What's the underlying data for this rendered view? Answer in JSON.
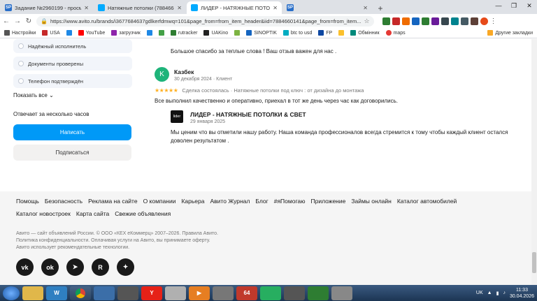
{
  "browser": {
    "tabs": [
      {
        "label": "Задание №2960199 - просмотр з",
        "favicon": "SP",
        "color": "#2a6fc9"
      },
      {
        "label": "Натяжные потолки (7884660141)",
        "favicon": "",
        "color": "#00aaff"
      },
      {
        "label": "ЛИДЕР - НАТЯЖНЫЕ ПОТОЛКИ & С",
        "favicon": "",
        "color": "#00aaff"
      },
      {
        "label": "",
        "favicon": "SP",
        "color": "#2a6fc9"
      }
    ],
    "url": "https://www.avito.ru/brands/i3677684637gdlkerfdmwq=101&page_from=from_item_header&iid=7884660141&page_from=from_item...",
    "bookmarks": [
      "Настройки",
      "USA",
      "",
      "YouTube",
      "загрузчик",
      "",
      "",
      "rutracker",
      "UAKino",
      "",
      "SINOPTIK",
      "btc to usd",
      "FP",
      "",
      "Обмінник",
      "maps"
    ],
    "bookmarks_right": "Другие закладки"
  },
  "sidebar": {
    "features": [
      "Надёжный исполнитель",
      "Документы проверены",
      "Телефон подтверждён"
    ],
    "show_all": "Показать все",
    "replies_note": "Отвечает за несколько часов",
    "write_button": "Написать",
    "subscribe_button": "Подписаться"
  },
  "reviews": {
    "previous_answer": "Большое спасибо за теплые слова ! Ваш отзыв важен для нас .",
    "review": {
      "avatar_letter": "K",
      "name": "Казбек",
      "meta": "30 декабря 2024 · Клиент",
      "stars": "★★★★★",
      "deal": "Сделка состоялась · Натяжные потолки под ключ : от дизайна до монтажа",
      "text": "Все выполнил качественно и оперативно, приехал в тот же день через час как договорились."
    },
    "reply": {
      "logo": "lider",
      "name": "ЛИДЕР - НАТЯЖНЫЕ ПОТОЛКИ & СВЕТ",
      "date": "29 января 2025",
      "text": "Мы ценим что вы отметили нашу работу. Наша команда профессионалов всегда стремится к тому чтобы каждый клиент остался доволен результатом ."
    }
  },
  "footer": {
    "links_row1": [
      "Помощь",
      "Безопасность",
      "Реклама на сайте",
      "О компании",
      "Карьера",
      "Авито Журнал",
      "Блог",
      "#яПомогаю",
      "Приложение",
      "Займы онлайн",
      "Каталог автомобилей"
    ],
    "links_row2": [
      "Каталог новостроек",
      "Карта сайта",
      "Свежие объявления"
    ],
    "legal_line1": "Авито — сайт объявлений России. © ООО «КЕХ еКоммерц» 2007–2026. Правила Авито.",
    "legal_line2": "Политика конфиденциальности. Оплачивая услуги на Авито, вы принимаете оферту.",
    "legal_line3": "Авито использует рекомендательные технологии.",
    "socials": [
      "vk-icon",
      "odnoklassniki-icon",
      "telegram-icon",
      "rutube-icon",
      "dzen-icon"
    ]
  },
  "taskbar": {
    "lang": "UK",
    "time": "11:33",
    "date": "30.04.2026"
  }
}
